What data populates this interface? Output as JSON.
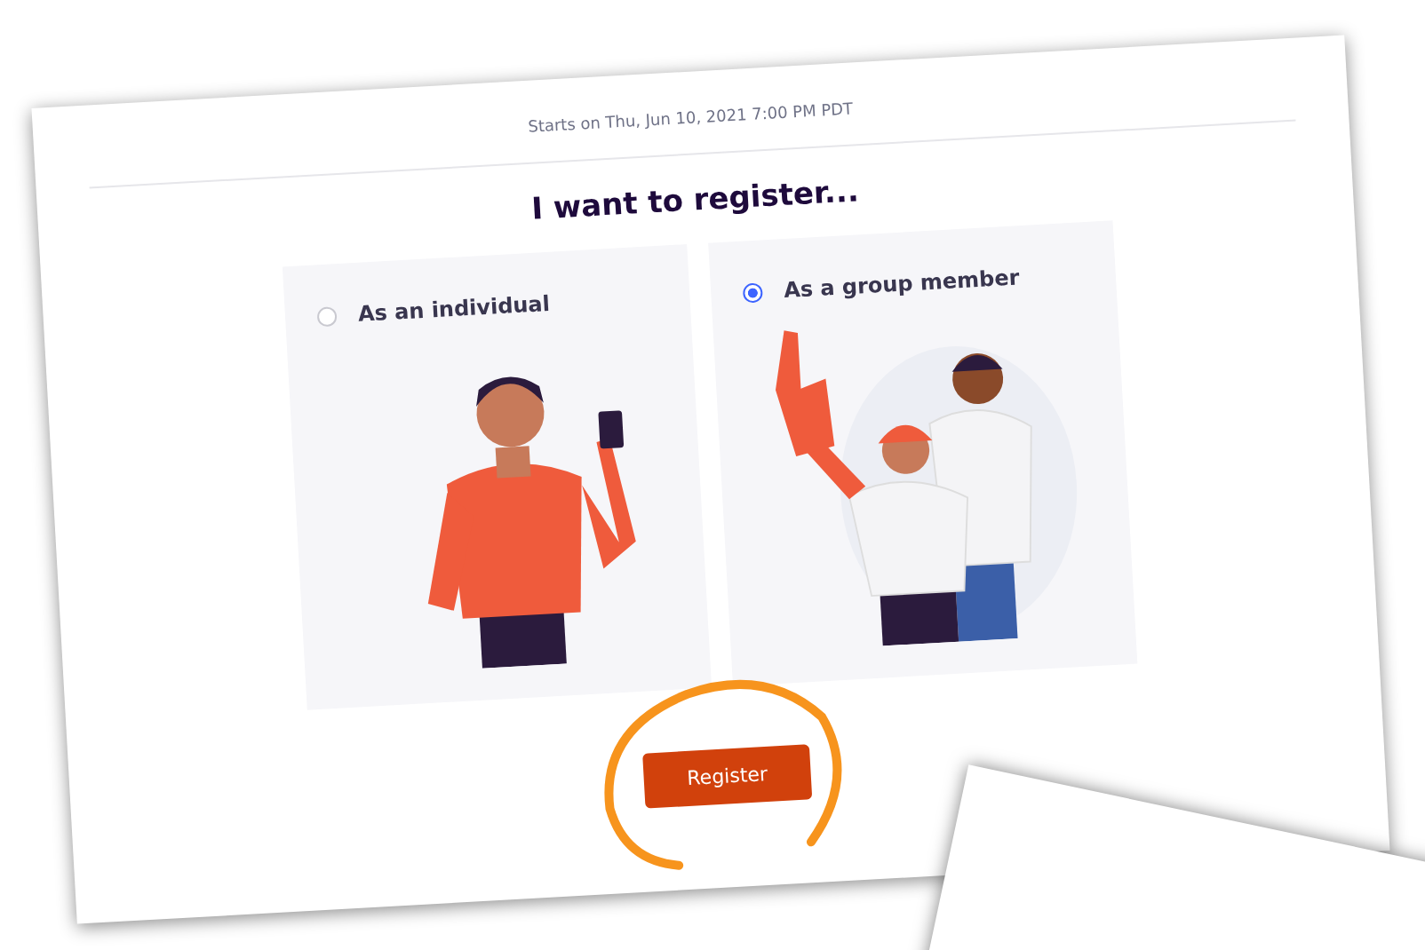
{
  "event_date": "Starts on Thu, Jun 10, 2021 7:00 PM PDT",
  "heading": "I want to register...",
  "options": [
    {
      "kind": "individual",
      "label": "As an individual",
      "selected": false
    },
    {
      "kind": "group",
      "label": "As a group member",
      "selected": true
    }
  ],
  "button": "Register"
}
